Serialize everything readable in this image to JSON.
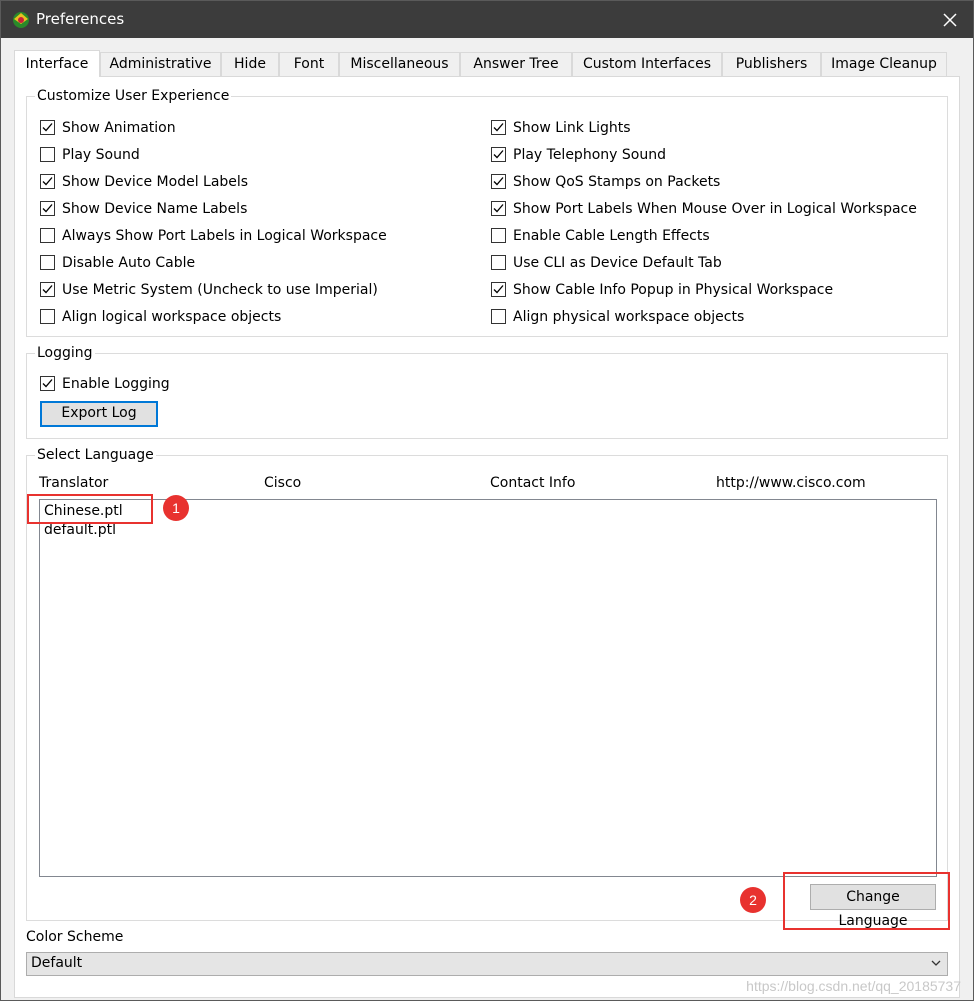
{
  "window": {
    "title": "Preferences",
    "app_icon": "packet-tracer-icon",
    "close_icon": "close-icon"
  },
  "tabs": [
    {
      "label": "Interface",
      "active": true
    },
    {
      "label": "Administrative"
    },
    {
      "label": "Hide"
    },
    {
      "label": "Font"
    },
    {
      "label": "Miscellaneous"
    },
    {
      "label": "Answer Tree"
    },
    {
      "label": "Custom Interfaces"
    },
    {
      "label": "Publishers"
    },
    {
      "label": "Image Cleanup"
    }
  ],
  "customize": {
    "title": "Customize User Experience",
    "left": [
      {
        "label": "Show Animation",
        "checked": true
      },
      {
        "label": "Play Sound",
        "checked": false
      },
      {
        "label": "Show Device Model Labels",
        "checked": true
      },
      {
        "label": "Show Device Name Labels",
        "checked": true
      },
      {
        "label": "Always Show Port Labels in Logical Workspace",
        "checked": false
      },
      {
        "label": "Disable Auto Cable",
        "checked": false
      },
      {
        "label": "Use Metric System (Uncheck to use Imperial)",
        "checked": true
      },
      {
        "label": "Align logical workspace objects",
        "checked": false
      }
    ],
    "right": [
      {
        "label": "Show Link Lights",
        "checked": true
      },
      {
        "label": "Play Telephony Sound",
        "checked": true
      },
      {
        "label": "Show QoS Stamps on Packets",
        "checked": true
      },
      {
        "label": "Show Port Labels When Mouse Over in Logical Workspace",
        "checked": true
      },
      {
        "label": "Enable Cable Length Effects",
        "checked": false
      },
      {
        "label": "Use CLI as Device Default Tab",
        "checked": false
      },
      {
        "label": "Show Cable Info Popup in Physical Workspace",
        "checked": true
      },
      {
        "label": "Align physical workspace objects",
        "checked": false
      }
    ]
  },
  "logging": {
    "title": "Logging",
    "enable_label": "Enable Logging",
    "enable_checked": true,
    "export_label": "Export Log"
  },
  "language": {
    "title": "Select Language",
    "header": [
      "Translator",
      "Cisco",
      "Contact Info",
      "http://www.cisco.com"
    ],
    "items": [
      "Chinese.ptl",
      "default.ptl"
    ],
    "change_label": "Change Language"
  },
  "annotations": {
    "badge1": "1",
    "badge2": "2",
    "color": "#e8322f"
  },
  "color_scheme": {
    "label": "Color Scheme",
    "value": "Default"
  },
  "watermark": "https://blog.csdn.net/qq_20185737"
}
